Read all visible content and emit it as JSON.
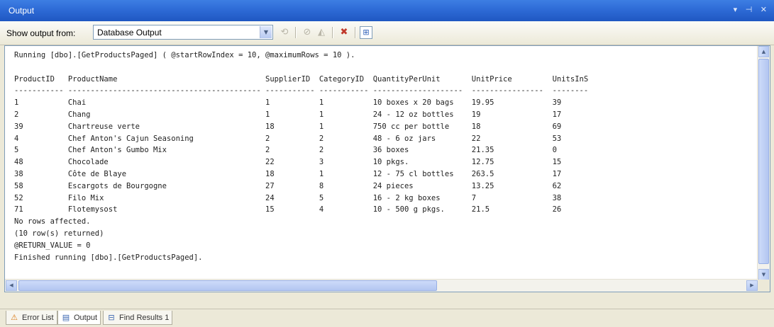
{
  "window": {
    "title": "Output",
    "controls": "▾ ⊣ ✕"
  },
  "toolbar": {
    "show_from_label": "Show output from:",
    "source_value": "Database Output"
  },
  "output": {
    "lines": [
      "Running [dbo].[GetProductsPaged] ( @startRowIndex = 10, @maximumRows = 10 ).",
      "",
      "ProductID   ProductName                                 SupplierID  CategoryID  QuantityPerUnit       UnitPrice         UnitsInS",
      "----------- ------------------------------------------- ----------- ----------- --------------------  ----------------  --------",
      "1           Chai                                        1           1           10 boxes x 20 bags    19.95             39",
      "2           Chang                                       1           1           24 - 12 oz bottles    19                17",
      "39          Chartreuse verte                            18          1           750 cc per bottle     18                69",
      "4           Chef Anton's Cajun Seasoning                2           2           48 - 6 oz jars        22                53",
      "5           Chef Anton's Gumbo Mix                      2           2           36 boxes              21.35             0",
      "48          Chocolade                                   22          3           10 pkgs.              12.75             15",
      "38          Côte de Blaye                               18          1           12 - 75 cl bottles    263.5             17",
      "58          Escargots de Bourgogne                      27          8           24 pieces             13.25             62",
      "52          Filo Mix                                    24          5           16 - 2 kg boxes       7                 38",
      "71          Flotemysost                                 15          4           10 - 500 g pkgs.      21.5              26",
      "No rows affected.",
      "(10 row(s) returned)",
      "@RETURN_VALUE = 0",
      "Finished running [dbo].[GetProductsPaged]."
    ]
  },
  "tabs": [
    {
      "label": "Error List",
      "icon": "error-list-icon"
    },
    {
      "label": "Output",
      "icon": "output-icon"
    },
    {
      "label": "Find Results 1",
      "icon": "find-results-icon"
    }
  ],
  "colors": {
    "titlebar": "#2e6bd6",
    "window": "#ece9d8",
    "text": "#222222"
  }
}
